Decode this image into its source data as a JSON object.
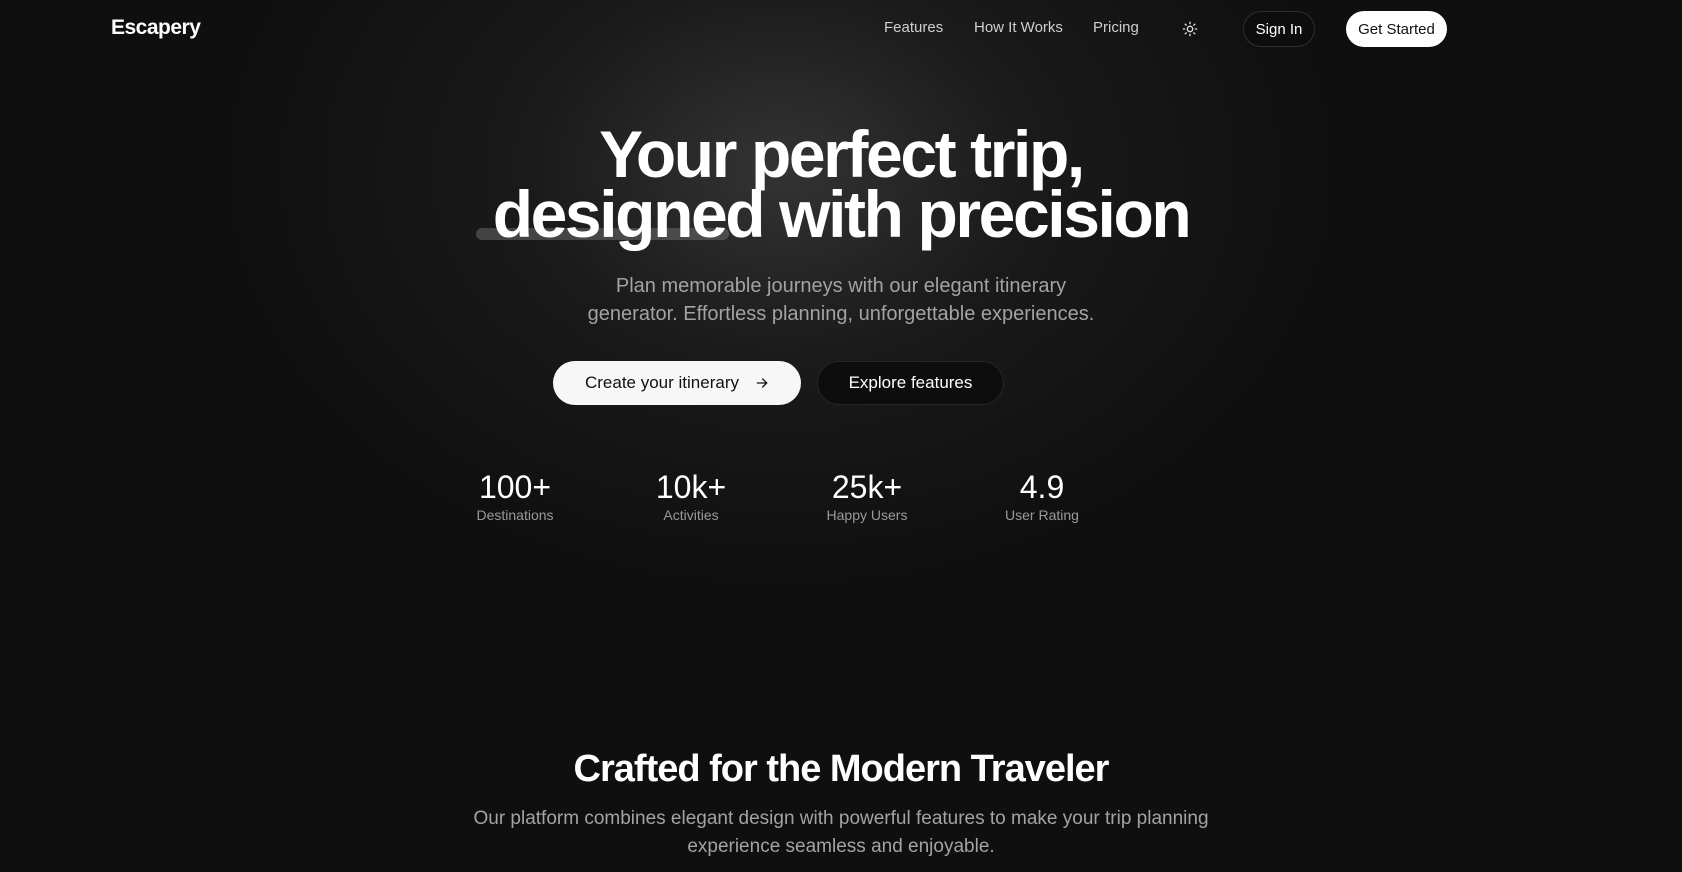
{
  "brand": {
    "name": "Escapery"
  },
  "nav": {
    "links": [
      {
        "label": "Features"
      },
      {
        "label": "How It Works"
      },
      {
        "label": "Pricing"
      }
    ],
    "theme_icon": "sun-icon",
    "sign_in_label": "Sign In",
    "get_started_label": "Get Started"
  },
  "hero": {
    "title_line1": "Your perfect trip,",
    "title_line2": "designed with precision",
    "subtitle_line1": "Plan memorable journeys with our elegant itinerary",
    "subtitle_line2": "generator. Effortless planning, unforgettable experiences.",
    "primary_cta": "Create your itinerary",
    "primary_cta_icon": "arrow-right-icon",
    "secondary_cta": "Explore features"
  },
  "stats": [
    {
      "value": "100+",
      "label": "Destinations"
    },
    {
      "value": "10k+",
      "label": "Activities"
    },
    {
      "value": "25k+",
      "label": "Happy Users"
    },
    {
      "value": "4.9",
      "label": "User Rating"
    }
  ],
  "features_section": {
    "title": "Crafted for the Modern Traveler",
    "subtitle_line1": "Our platform combines elegant design with powerful features to make your trip planning",
    "subtitle_line2": "experience seamless and enjoyable."
  },
  "colors": {
    "background": "#0f0f0f",
    "text_primary": "#ffffff",
    "text_muted": "#a3a3a3",
    "button_light": "#f7f7f7"
  }
}
